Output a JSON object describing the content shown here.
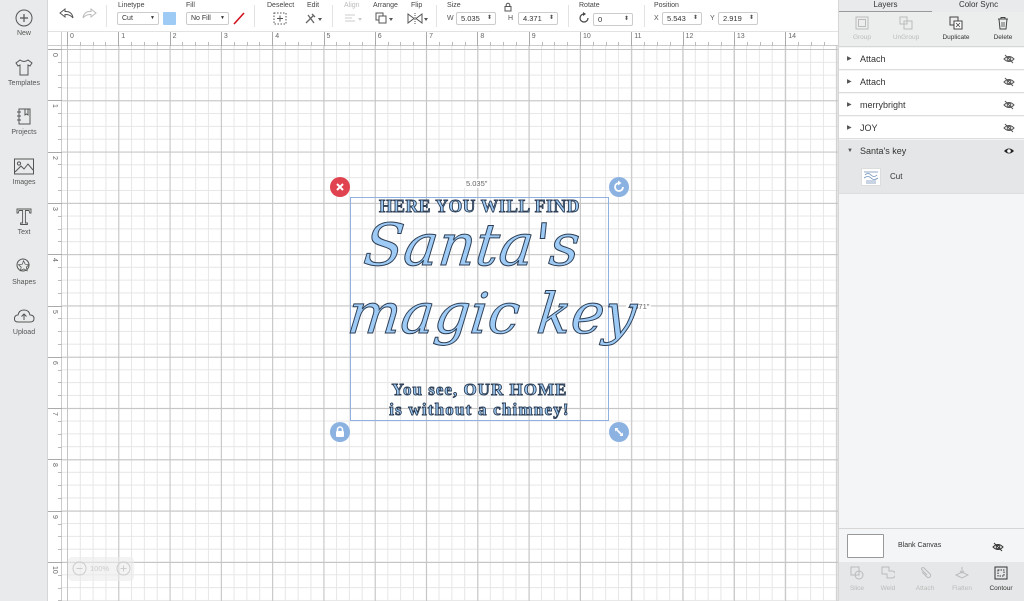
{
  "left_sidebar": {
    "items": [
      {
        "label": "New",
        "icon": "plus-circle-icon"
      },
      {
        "label": "Templates",
        "icon": "tshirt-icon"
      },
      {
        "label": "Projects",
        "icon": "notebook-icon"
      },
      {
        "label": "Images",
        "icon": "image-icon"
      },
      {
        "label": "Text",
        "icon": "text-t-icon"
      },
      {
        "label": "Shapes",
        "icon": "shapes-icon"
      },
      {
        "label": "Upload",
        "icon": "cloud-upload-icon"
      }
    ]
  },
  "toolbar": {
    "undo_icon": "undo-icon",
    "redo_icon": "redo-icon",
    "linetype": {
      "label": "Linetype",
      "value": "Cut"
    },
    "linetype_color": "#9ecbf5",
    "fill": {
      "label": "Fill",
      "value": "No Fill"
    },
    "deselect_label": "Deselect",
    "edit_label": "Edit",
    "align_label": "Align",
    "arrange_label": "Arrange",
    "flip_label": "Flip",
    "size": {
      "label": "Size",
      "w_label": "W",
      "w_value": "5.035",
      "h_label": "H",
      "h_value": "4.371"
    },
    "rotate": {
      "label": "Rotate",
      "value": "0"
    },
    "position": {
      "label": "Position",
      "x_label": "X",
      "x_value": "5.543",
      "y_label": "Y",
      "y_value": "2.919"
    }
  },
  "rulers": {
    "horizontal": [
      "0",
      "1",
      "2",
      "3",
      "4",
      "5",
      "6",
      "7",
      "8",
      "9",
      "10",
      "11",
      "12",
      "13",
      "14"
    ],
    "vertical": [
      "0",
      "1",
      "2",
      "3",
      "4",
      "5",
      "6",
      "7",
      "8",
      "9",
      "10"
    ]
  },
  "canvas": {
    "selection": {
      "width_label": "5.035\"",
      "height_label": "4.371\""
    },
    "design": {
      "line1": "HERE YOU WILL FIND",
      "line2": "Santa's",
      "line3": "magic key",
      "line4": "You see, OUR HOME",
      "line5": "is without a chimney!"
    },
    "colors": {
      "fill": "#9ecbf5",
      "outline": "#2d3e55",
      "selection": "#8fb2e0",
      "delete_handle": "#e0434f",
      "blue_handle": "#8cb2e2"
    },
    "zoom": {
      "value": "100%"
    }
  },
  "right_panel": {
    "tabs": [
      {
        "label": "Layers",
        "active": true
      },
      {
        "label": "Color Sync",
        "active": false
      }
    ],
    "actions": [
      {
        "label": "Group",
        "enabled": false
      },
      {
        "label": "UnGroup",
        "enabled": false
      },
      {
        "label": "Duplicate",
        "enabled": true
      },
      {
        "label": "Delete",
        "enabled": true
      }
    ],
    "layers": [
      {
        "name": "Attach",
        "expanded": false,
        "visible": false
      },
      {
        "name": "Attach",
        "expanded": false,
        "visible": false
      },
      {
        "name": "merrybright",
        "expanded": false,
        "visible": false
      },
      {
        "name": "JOY",
        "expanded": false,
        "visible": false
      },
      {
        "name": "Santa's key",
        "expanded": true,
        "visible": true,
        "children": [
          {
            "name": "Cut"
          }
        ]
      }
    ],
    "blank_canvas": {
      "label": "Blank Canvas",
      "visible": false
    },
    "bottom_actions": [
      {
        "label": "Slice",
        "enabled": false
      },
      {
        "label": "Weld",
        "enabled": false
      },
      {
        "label": "Attach",
        "enabled": false
      },
      {
        "label": "Flatten",
        "enabled": false
      },
      {
        "label": "Contour",
        "enabled": true
      }
    ]
  }
}
